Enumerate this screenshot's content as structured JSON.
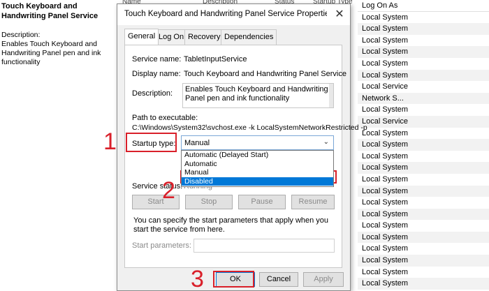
{
  "background": {
    "service_title": "Touch Keyboard and Handwriting Panel Service",
    "description_label": "Description:",
    "description_text": "Enables Touch Keyboard and Handwriting Panel pen and ink functionality",
    "columns": [
      "Name",
      "Description",
      "Status",
      "Startup Type"
    ],
    "logon_header": "Log On As",
    "logon_rows": [
      "Local System",
      "Local System",
      "Local System",
      "Local System",
      "Local System",
      "Local System",
      "Local Service",
      "Network S...",
      "Local System",
      "Local Service",
      "Local System",
      "Local System",
      "Local System",
      "Local System",
      "Local System",
      "Local System",
      "Local System",
      "Local System",
      "Local System",
      "Local System",
      "Local System",
      "Local System",
      "Local System",
      "Local System"
    ]
  },
  "dialog": {
    "title": "Touch Keyboard and Handwriting Panel Service Properties (Local C...",
    "close_glyph": "✕",
    "tabs": [
      "General",
      "Log On",
      "Recovery",
      "Dependencies"
    ],
    "service_name_label": "Service name:",
    "service_name_value": "TabletInputService",
    "display_name_label": "Display name:",
    "display_name_value": "Touch Keyboard and Handwriting Panel Service",
    "description_label": "Description:",
    "description_value": "Enables Touch Keyboard and Handwriting Panel pen and ink functionality",
    "path_label": "Path to executable:",
    "path_value": "C:\\Windows\\System32\\svchost.exe -k LocalSystemNetworkRestricted -p",
    "startup_type_label": "Startup type:",
    "startup_type_value": "Manual",
    "startup_options": [
      "Automatic (Delayed Start)",
      "Automatic",
      "Manual",
      "Disabled"
    ],
    "startup_highlighted": "Disabled",
    "service_status_label": "Service status:",
    "service_status_value": "Running",
    "buttons": {
      "start": "Start",
      "stop": "Stop",
      "pause": "Pause",
      "resume": "Resume"
    },
    "hint": "You can specify the start parameters that apply when you start the service from here.",
    "start_params_label": "Start parameters:",
    "ok": "OK",
    "cancel": "Cancel",
    "apply": "Apply"
  },
  "annotations": {
    "step1": "1",
    "step2": "2",
    "step3": "3",
    "color": "#d9202a"
  },
  "colors": {
    "selection": "#0078d7",
    "dialog_bg": "#f0f0f0"
  }
}
